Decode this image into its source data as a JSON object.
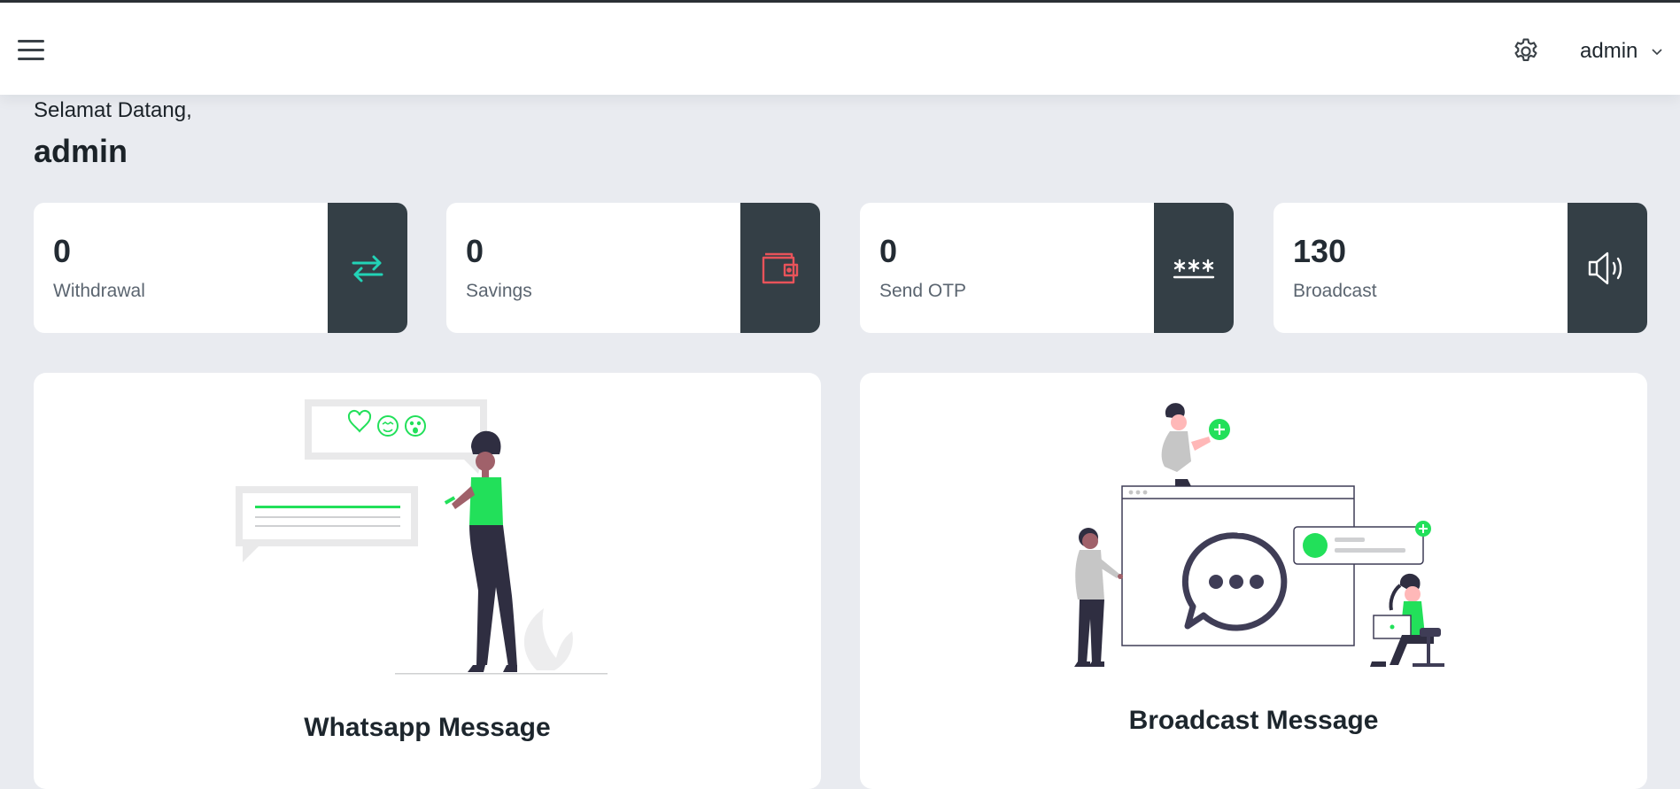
{
  "header": {
    "user_name": "admin"
  },
  "welcome": {
    "greeting": "Selamat Datang,",
    "name": "admin"
  },
  "stats": [
    {
      "value": "0",
      "label": "Withdrawal",
      "icon": "transfer-arrows-icon",
      "icon_color": "#22d3b6"
    },
    {
      "value": "0",
      "label": "Savings",
      "icon": "wallet-icon",
      "icon_color": "#e8535a"
    },
    {
      "value": "0",
      "label": "Send OTP",
      "icon": "password-asterisk-icon",
      "icon_color": "#ffffff"
    },
    {
      "value": "130",
      "label": "Broadcast",
      "icon": "speaker-icon",
      "icon_color": "#ffffff"
    }
  ],
  "cards": [
    {
      "title": "Whatsapp Message"
    },
    {
      "title": "Broadcast Message"
    }
  ],
  "colors": {
    "icon_box": "#343f46",
    "accent_green": "#22e05a",
    "background": "#e9ebf0"
  }
}
